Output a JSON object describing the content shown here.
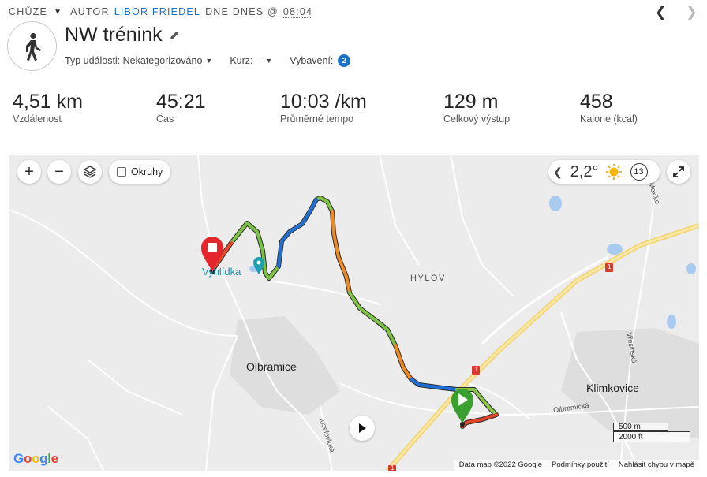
{
  "header": {
    "activity_type": "Chůze",
    "author_prefix": "AUTOR",
    "author_name": "LIBOR FRIEDEL",
    "date_label": "DNE DNES @",
    "time": "08:04"
  },
  "activity": {
    "title": "NW trénink",
    "event_type": "Typ události: Nekategorizováno",
    "course": "Kurz: --",
    "gear_label": "Vybavení:",
    "gear_count": "2"
  },
  "stats": [
    {
      "value": "4,51 km",
      "label": "Vzdálenost"
    },
    {
      "value": "45:21",
      "label": "Čas"
    },
    {
      "value": "10:03 /km",
      "label": "Průměrné tempo"
    },
    {
      "value": "129 m",
      "label": "Celkový výstup"
    },
    {
      "value": "458",
      "label": "Kalorie (kcal)"
    }
  ],
  "map": {
    "zoom_in": "+",
    "zoom_out": "−",
    "laps_label": "Okruhy",
    "weather": {
      "temp": "2,2°",
      "wind": "13"
    },
    "places": {
      "olbramice": "Olbramice",
      "klimkovice": "Klimkovice",
      "hylov": "HÝLOV",
      "vyhlidka": "Vyhlídka",
      "olbramicka": "Olbramická",
      "josefovicka": "Josefovická",
      "vresinska": "Vřesinská",
      "mexiko": "Mexiko",
      "road_1": "1",
      "road_1b": "1",
      "road_1c": "1"
    },
    "scale": {
      "metric": "500 m",
      "imperial": "2000 ft"
    },
    "attribution": {
      "data": "Data map ©2022 Google",
      "terms": "Podmínky použití",
      "report": "Nahlásit chybu v mapě"
    },
    "logo": "Google"
  }
}
